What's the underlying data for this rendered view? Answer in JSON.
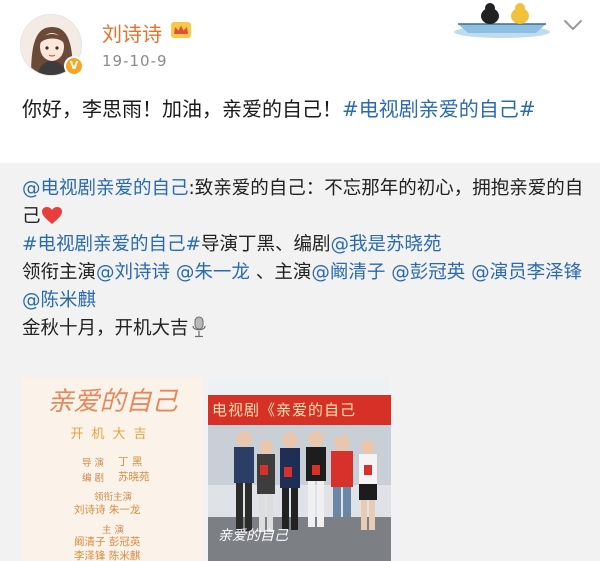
{
  "post": {
    "author": "刘诗诗",
    "date": "19-10-9",
    "text_plain": "你好，李思雨！加油，亲爱的自己！",
    "text_tag": "#电视剧亲爱的自己#"
  },
  "repost": {
    "mention_1": "@电视剧亲爱的自己",
    "text_1": ":致亲爱的自己：不忘那年的初心，拥抱亲爱的自己",
    "tag_1": "#电视剧亲爱的自己#",
    "text_2": "导演丁黑、编剧",
    "mention_2": "@我是苏晓苑",
    "text_3": "领衔主演",
    "mention_3": "@刘诗诗",
    "mention_4": "@朱一龙",
    "text_4": "、主演",
    "mention_5": "@阚清子",
    "mention_6": "@彭冠英",
    "mention_7": "@演员李泽锋",
    "mention_8": "@陈米麒",
    "text_5": "金秋十月，开机大吉"
  },
  "poster": {
    "title": "亲爱的自己",
    "subtitle": "开机大吉",
    "director_role": "导 演",
    "director_name": "丁 黑",
    "writer_role": "编 剧",
    "writer_name": "苏晓苑",
    "lead_role": "领衔主演",
    "lead_names": "刘诗诗 朱一龙",
    "cast_role": "主 演",
    "cast_names_1": "阚清子 彭冠英",
    "cast_names_2": "李泽锋 陈米麒"
  },
  "photo": {
    "banner": "电视剧《亲爱的自己",
    "watermark": "亲爱的自己"
  },
  "colors": {
    "username": "#e8702a",
    "link": "#2a6ab0",
    "repost_bg": "#f2f2f2",
    "banner": "#d63027"
  },
  "icons": [
    "crown-icon",
    "verified-badge",
    "chevron-down-icon",
    "heart-icon",
    "mic-icon"
  ]
}
